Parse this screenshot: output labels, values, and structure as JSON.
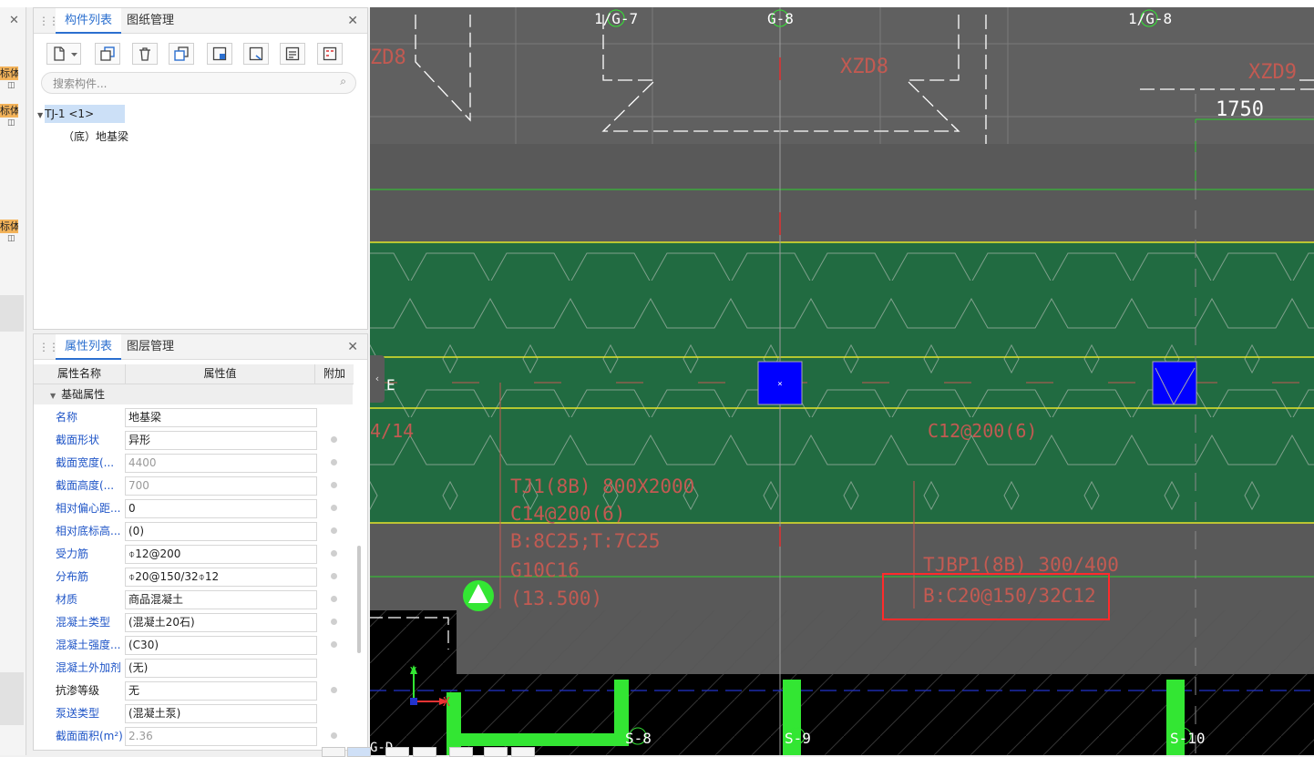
{
  "left_strip": {
    "close": "✕",
    "badges": [
      "标体验",
      "标体验",
      "标体验"
    ]
  },
  "component_panel": {
    "tabs": [
      "构件列表",
      "图纸管理"
    ],
    "close": "✕",
    "search": {
      "placeholder": "搜索构件..."
    },
    "tree": {
      "root": "TJ-1 <1>",
      "child": "（底）地基梁"
    },
    "toolbar_icons": [
      "new-icon",
      "dropdown-arrow-icon",
      "copy-icon",
      "delete-icon",
      "layer-copy-icon",
      "save-icon",
      "export-icon",
      "list-icon",
      "calc-icon"
    ]
  },
  "property_panel": {
    "tabs": [
      "属性列表",
      "图层管理"
    ],
    "close": "✕",
    "headers": {
      "name": "属性名称",
      "value": "属性值",
      "extra": "附加"
    },
    "group": "基础属性",
    "rows": [
      {
        "name": "名称",
        "value": "地基梁",
        "gray": false,
        "blue": true,
        "dot": false
      },
      {
        "name": "截面形状",
        "value": "异形",
        "gray": false,
        "blue": true,
        "dot": true
      },
      {
        "name": "截面宽度(...",
        "value": "4400",
        "gray": true,
        "blue": true,
        "dot": true
      },
      {
        "name": "截面高度(...",
        "value": "700",
        "gray": true,
        "blue": true,
        "dot": true
      },
      {
        "name": "相对偏心距...",
        "value": "0",
        "gray": false,
        "blue": true,
        "dot": true
      },
      {
        "name": "相对底标高...",
        "value": "(0)",
        "gray": false,
        "blue": true,
        "dot": true
      },
      {
        "name": "受力筋",
        "value": "⌽12@200",
        "gray": false,
        "blue": true,
        "dot": true
      },
      {
        "name": "分布筋",
        "value": "⌽20@150/32⌽12",
        "gray": false,
        "blue": true,
        "dot": true
      },
      {
        "name": "材质",
        "value": "商品混凝土",
        "gray": false,
        "blue": true,
        "dot": true
      },
      {
        "name": "混凝土类型",
        "value": "(混凝土20石)",
        "gray": false,
        "blue": true,
        "dot": true
      },
      {
        "name": "混凝土强度...",
        "value": "(C30)",
        "gray": false,
        "blue": true,
        "dot": true
      },
      {
        "name": "混凝土外加剂",
        "value": "(无)",
        "gray": false,
        "blue": true,
        "dot": false
      },
      {
        "name": "抗渗等级",
        "value": "无",
        "gray": false,
        "blue": false,
        "dot": true
      },
      {
        "name": "泵送类型",
        "value": "(混凝土泵)",
        "gray": false,
        "blue": true,
        "dot": false
      },
      {
        "name": "截面面积(m²)",
        "value": "2.36",
        "gray": true,
        "blue": true,
        "dot": true
      }
    ]
  },
  "canvas": {
    "axis_labels": {
      "g7": "1/G-7",
      "g8": "G-8",
      "g8b": "1/G-8",
      "s8": "S-8",
      "s9": "S-9",
      "s10": "S-10",
      "gd": "G-D",
      "e": "E"
    },
    "labels": {
      "xzd8_left": "ZD8",
      "xzd8": "XZD8",
      "xzd9": "XZD9",
      "dim": "1750",
      "left_frag": "4/14",
      "tj1_line1": "TJ1(8B) 800X2000",
      "tj1_line2": "C14@200(6)",
      "tj1_line3": "B:8C25;T:7C25",
      "tj1_line4": "G10C16",
      "tj1_line5": "(13.500)",
      "c12": "C12@200(6)",
      "tjbp1_line1": "TJBP1(8B) 300/400",
      "tjbp1_line2": "B:C20@150/32C12",
      "x_axis": "X",
      "y_axis": "Y"
    },
    "colors": {
      "foundation": "#216b41",
      "column": "#0000ff",
      "rebar": "#33e633",
      "annotation": "#c25a52",
      "highlight": "#ff2b2b",
      "background": "#595959"
    }
  }
}
